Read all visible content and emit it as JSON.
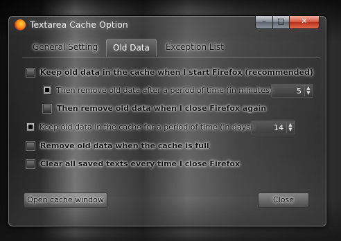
{
  "window": {
    "title": "Textarea Cache Option"
  },
  "title_buttons": {
    "minimize": "–",
    "maximize": "□",
    "close": "✕"
  },
  "tabs": [
    {
      "label": "General Setting"
    },
    {
      "label": "Old Data"
    },
    {
      "label": "Exception List"
    }
  ],
  "options": {
    "keep_old_startup": {
      "label": "Keep old data in the cache when I start Firefox (recommended)",
      "checked": false
    },
    "remove_after_minutes": {
      "label": "Then remove old data after a period of time (in minutes):",
      "value": "5"
    },
    "remove_on_close": {
      "label": "Then remove old data when I close Firefox again",
      "checked": false
    },
    "keep_days": {
      "label": "Keep old data in the cache for a period of time (in days):",
      "value": "14"
    },
    "remove_when_full": {
      "label": "Remove old data when the cache is full",
      "checked": false
    },
    "clear_on_close": {
      "label": "Clear all saved texts every time I close Firefox",
      "checked": false
    }
  },
  "buttons": {
    "open_cache": "Open cache window",
    "close": "Close"
  },
  "icons": {
    "spin_up": "▲",
    "spin_down": "▼",
    "spin_toggle": "■"
  }
}
